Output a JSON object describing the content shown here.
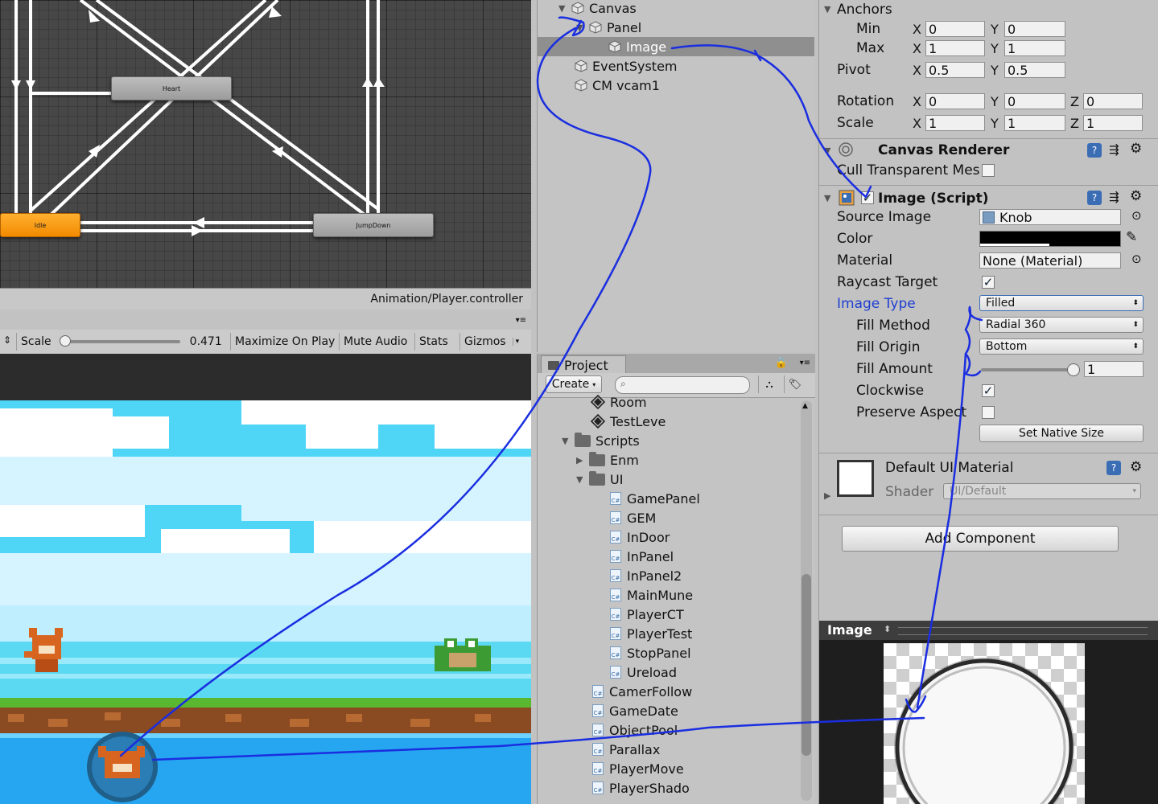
{
  "animator": {
    "states": {
      "heart": "Heart",
      "idle": "Idle",
      "jumpdown": "JumpDown"
    },
    "footer_path": "Animation/Player.controller"
  },
  "game_toolbar": {
    "scale_label": "Scale",
    "scale_value": "0.471",
    "scale_fraction": 0.0,
    "maximize_label": "Maximize On Play",
    "mute_label": "Mute Audio",
    "stats_label": "Stats",
    "gizmos_label": "Gizmos"
  },
  "hierarchy": {
    "items": [
      {
        "label": "Canvas"
      },
      {
        "label": "Panel"
      },
      {
        "label": "Image"
      },
      {
        "label": "EventSystem"
      },
      {
        "label": "CM vcam1"
      }
    ]
  },
  "project": {
    "tab_label": "Project",
    "create_label": "Create",
    "search_placeholder": "",
    "items": [
      {
        "label": "Room",
        "icon": "unity-scene-icon"
      },
      {
        "label": "TestLeve",
        "icon": "unity-scene-icon"
      },
      {
        "label": "Scripts",
        "icon": "folder-icon"
      },
      {
        "label": "Enm",
        "icon": "folder-icon"
      },
      {
        "label": "UI",
        "icon": "folder-icon"
      },
      {
        "label": "GamePanel",
        "icon": "csharp-icon"
      },
      {
        "label": "GEM",
        "icon": "csharp-icon"
      },
      {
        "label": "InDoor",
        "icon": "csharp-icon"
      },
      {
        "label": "InPanel",
        "icon": "csharp-icon"
      },
      {
        "label": "InPanel2",
        "icon": "csharp-icon"
      },
      {
        "label": "MainMune",
        "icon": "csharp-icon"
      },
      {
        "label": "PlayerCT",
        "icon": "csharp-icon"
      },
      {
        "label": "PlayerTest",
        "icon": "csharp-icon"
      },
      {
        "label": "StopPanel",
        "icon": "csharp-icon"
      },
      {
        "label": "Ureload",
        "icon": "csharp-icon"
      },
      {
        "label": "CamerFollow",
        "icon": "csharp-icon"
      },
      {
        "label": "GameDate",
        "icon": "csharp-icon"
      },
      {
        "label": "ObjectPool",
        "icon": "csharp-icon"
      },
      {
        "label": "Parallax",
        "icon": "csharp-icon"
      },
      {
        "label": "PlayerMove",
        "icon": "csharp-icon"
      },
      {
        "label": "PlayerShado",
        "icon": "csharp-icon"
      }
    ]
  },
  "inspector": {
    "anchors": {
      "title": "Anchors",
      "min_label": "Min",
      "min_x": "0",
      "min_y": "0",
      "max_label": "Max",
      "max_x": "1",
      "max_y": "1",
      "pivot_label": "Pivot",
      "pivot_x": "0.5",
      "pivot_y": "0.5"
    },
    "axis": {
      "x": "X",
      "y": "Y",
      "z": "Z"
    },
    "rotation": {
      "label": "Rotation",
      "x": "0",
      "y": "0",
      "z": "0"
    },
    "scale": {
      "label": "Scale",
      "x": "1",
      "y": "1",
      "z": "1"
    },
    "canvas_renderer": {
      "title": "Canvas Renderer",
      "cull_label": "Cull Transparent Mes",
      "cull_checked": false
    },
    "image_script": {
      "title": "Image (Script)",
      "source_image_label": "Source Image",
      "source_image_value": "Knob",
      "color_label": "Color",
      "color_value": "#000000",
      "material_label": "Material",
      "material_value": "None (Material)",
      "raycast_label": "Raycast Target",
      "raycast_checked": true,
      "image_type_label": "Image Type",
      "image_type_value": "Filled",
      "fill_method_label": "Fill Method",
      "fill_method_value": "Radial 360",
      "fill_origin_label": "Fill Origin",
      "fill_origin_value": "Bottom",
      "fill_amount_label": "Fill Amount",
      "fill_amount_value": "1",
      "fill_amount_fraction": 1,
      "clockwise_label": "Clockwise",
      "clockwise_checked": true,
      "preserve_label": "Preserve Aspect",
      "preserve_checked": false,
      "set_native_label": "Set Native Size"
    },
    "material_section": {
      "title": "Default UI Material",
      "shader_label": "Shader",
      "shader_value": "UI/Default"
    },
    "add_component_label": "Add Component",
    "preview": {
      "title": "Image"
    }
  },
  "colors": {
    "animator_bg": "#474747",
    "idle_state": "#f28a00",
    "selection": "#8f8f8f",
    "annotation_ink": "#1a2ee0",
    "sky": "#4fd6f7",
    "highlight_label": "#1f3fd1"
  }
}
